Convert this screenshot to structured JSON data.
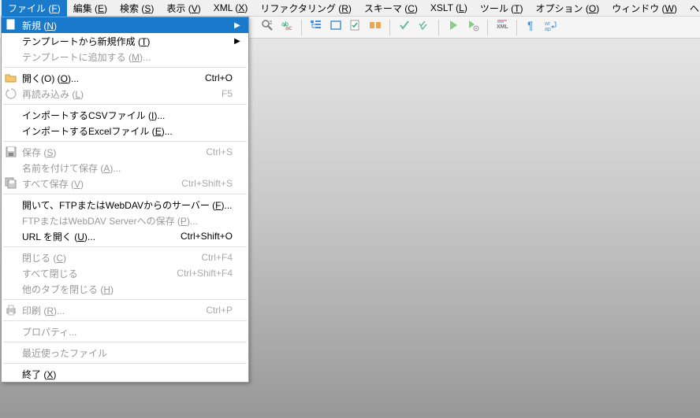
{
  "menubar": [
    {
      "label": "ファイル",
      "accel": "F",
      "active": true
    },
    {
      "label": "編集",
      "accel": "E"
    },
    {
      "label": "検索",
      "accel": "S"
    },
    {
      "label": "表示",
      "accel": "V"
    },
    {
      "label": "XML",
      "accel": "X"
    },
    {
      "label": "リファクタリング",
      "accel": "R"
    },
    {
      "label": "スキーマ",
      "accel": "C"
    },
    {
      "label": "XSLT",
      "accel": "L"
    },
    {
      "label": "ツール",
      "accel": "T"
    },
    {
      "label": "オプション",
      "accel": "O"
    },
    {
      "label": "ウィンドウ",
      "accel": "W"
    },
    {
      "label": "ヘルプ",
      "accel": "H"
    }
  ],
  "file_menu": [
    {
      "type": "item",
      "icon": "new-file-icon",
      "label": "新規",
      "accel": "N",
      "submenu": true,
      "highlight": true
    },
    {
      "type": "item",
      "label": "テンプレートから新規作成",
      "accel": "T",
      "submenu": true
    },
    {
      "type": "item",
      "label": "テンプレートに追加する",
      "accel": "M",
      "ellipsis": true,
      "disabled": true
    },
    {
      "type": "sep"
    },
    {
      "type": "item",
      "icon": "folder-open-icon",
      "label": "開く(O)",
      "accel": "O",
      "ellipsis": true,
      "shortcut": "Ctrl+O"
    },
    {
      "type": "item",
      "icon": "reload-icon",
      "label": "再読み込み",
      "accel": "L",
      "shortcut": "F5",
      "disabled": true
    },
    {
      "type": "sep"
    },
    {
      "type": "item",
      "label": "インポートするCSVファイル",
      "accel": "I",
      "ellipsis": true
    },
    {
      "type": "item",
      "label": "インポートするExcelファイル",
      "accel": "E",
      "ellipsis": true
    },
    {
      "type": "sep"
    },
    {
      "type": "item",
      "icon": "save-icon",
      "label": "保存",
      "accel": "S",
      "shortcut": "Ctrl+S",
      "disabled": true
    },
    {
      "type": "item",
      "label": "名前を付けて保存",
      "accel": "A",
      "ellipsis": true,
      "disabled": true
    },
    {
      "type": "item",
      "icon": "save-all-icon",
      "label": "すべて保存",
      "accel": "V",
      "shortcut": "Ctrl+Shift+S",
      "disabled": true
    },
    {
      "type": "sep"
    },
    {
      "type": "item",
      "label": "開いて、FTPまたはWebDAVからのサーバー",
      "accel": "F",
      "ellipsis": true
    },
    {
      "type": "item",
      "label": "FTPまたはWebDAV Serverへの保存",
      "accel": "P",
      "ellipsis": true,
      "disabled": true
    },
    {
      "type": "item",
      "label": "URL を開く",
      "accel": "U",
      "ellipsis": true,
      "shortcut": "Ctrl+Shift+O"
    },
    {
      "type": "sep"
    },
    {
      "type": "item",
      "label": "閉じる",
      "accel": "C",
      "shortcut": "Ctrl+F4",
      "disabled": true
    },
    {
      "type": "item",
      "label": "すべて閉じる",
      "shortcut": "Ctrl+Shift+F4",
      "disabled": true
    },
    {
      "type": "item",
      "label": "他のタブを閉じる",
      "accel": "H",
      "disabled": true
    },
    {
      "type": "sep"
    },
    {
      "type": "item",
      "icon": "print-icon",
      "label": "印刷",
      "accel": "R",
      "ellipsis": true,
      "shortcut": "Ctrl+P",
      "disabled": true
    },
    {
      "type": "sep"
    },
    {
      "type": "item",
      "label": "プロパティ...",
      "disabled": true
    },
    {
      "type": "sep"
    },
    {
      "type": "item",
      "label": "最近使ったファイル",
      "disabled": true
    },
    {
      "type": "sep"
    },
    {
      "type": "item",
      "label": "終了",
      "accel": "X"
    }
  ],
  "toolbar": {
    "groups": [
      [
        "find-icon",
        "find-replace-icon"
      ],
      [
        "structure-icon",
        "rect-icon",
        "validate-icon",
        "tags-icon"
      ],
      [
        "check-icon",
        "double-check-icon"
      ],
      [
        "play-icon",
        "play-settings-icon"
      ],
      [
        "xml-icon"
      ],
      [
        "pilcrow-icon",
        "wrap-icon"
      ]
    ]
  }
}
